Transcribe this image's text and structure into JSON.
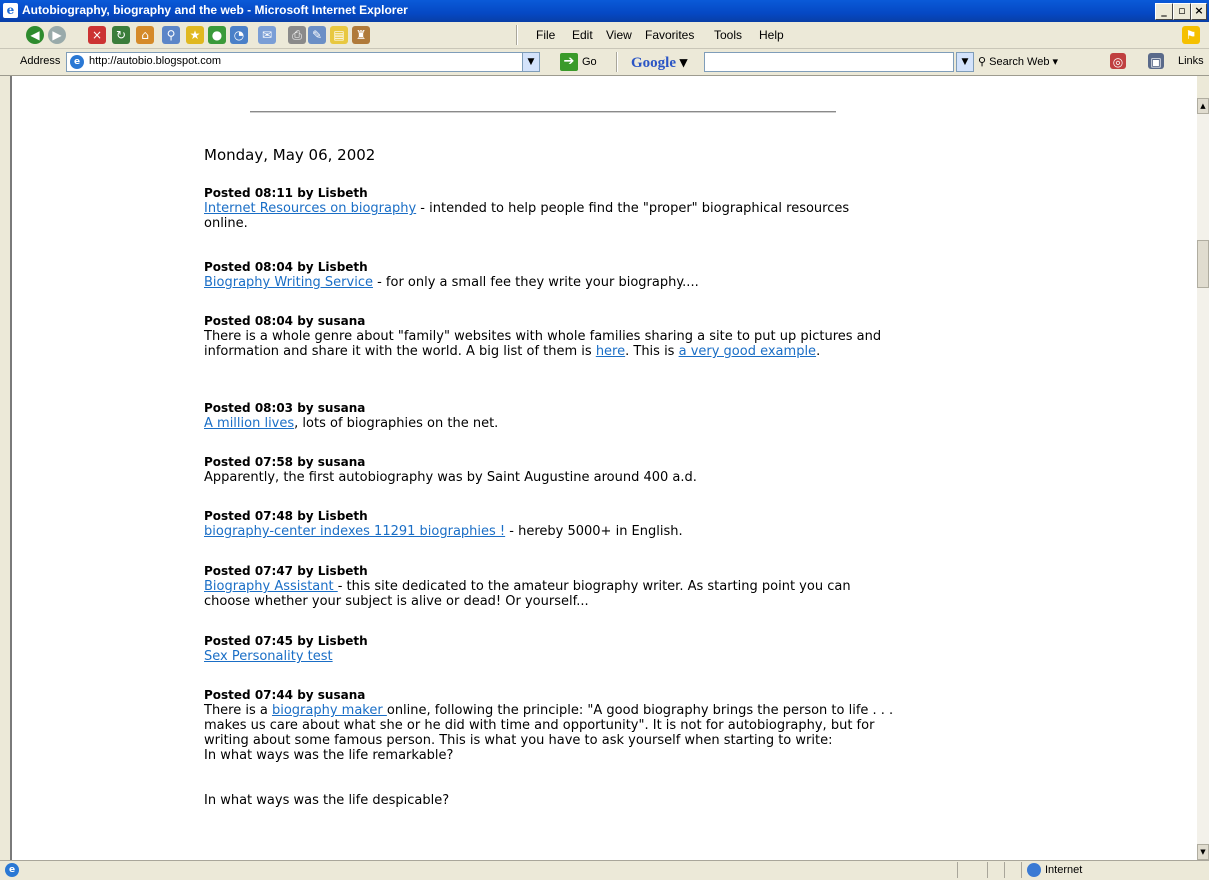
{
  "window": {
    "title": "Autobiography, biography and the web - Microsoft Internet Explorer",
    "min": "_",
    "max": "▫",
    "close": "×"
  },
  "menu": [
    "File",
    "Edit",
    "View",
    "Favorites",
    "Tools",
    "Help"
  ],
  "address": {
    "label": "Address",
    "url": "http://autobio.blogspot.com",
    "go_label": "Go"
  },
  "google": {
    "logo": "Google",
    "search_web_label": "Search Web"
  },
  "links_label": "Links",
  "blog": {
    "date": "Monday, May 06, 2002",
    "posts": [
      {
        "header": "Posted 08:11 by Lisbeth",
        "link": "Internet Resources on biography",
        "text": " - intended to help people find the \"proper\" biographical resources online."
      },
      {
        "header": "Posted 08:04 by Lisbeth",
        "link": "Biography Writing Service",
        "text": " - for only a small fee they write your biography...."
      },
      {
        "header": "Posted 08:04 by susana",
        "text1": "There is a whole genre about \"family\" websites with whole families sharing a site to put up pictures and information and share it with the world. A big list of them is ",
        "link1": "here",
        "text2": ". This is ",
        "link2": "a very good example",
        "text3": "."
      },
      {
        "header": "Posted 08:03 by susana",
        "link": "A million lives",
        "text": ", lots of biographies on the net."
      },
      {
        "header": "Posted 07:58 by susana",
        "text": "Apparently, the first autobiography was by Saint Augustine around 400 a.d."
      },
      {
        "header": "Posted 07:48 by Lisbeth",
        "link": "biography-center indexes 11291 biographies !",
        "text": " - hereby 5000+ in English."
      },
      {
        "header": "Posted 07:47 by Lisbeth",
        "link": "Biography Assistant ",
        "text": "- this site dedicated to the amateur biography writer. As starting point you can choose whether your subject is alive or dead! Or yourself..."
      },
      {
        "header": "Posted 07:45 by Lisbeth",
        "link": "Sex Personality test"
      },
      {
        "header": "Posted 07:44 by susana",
        "text1": "There is a ",
        "link": "biography maker ",
        "text2": "online, following the principle: \"A good biography brings the person to life . . .",
        "line2": "makes us care about what she or he did with time and opportunity\". It is not for autobiography, but for writing about some famous person. This is what you have to ask yourself when starting to write:",
        "line3": "In what ways was the life remarkable?",
        "line4": "In what ways was the life despicable?"
      }
    ]
  },
  "status": {
    "zone": "Internet"
  }
}
